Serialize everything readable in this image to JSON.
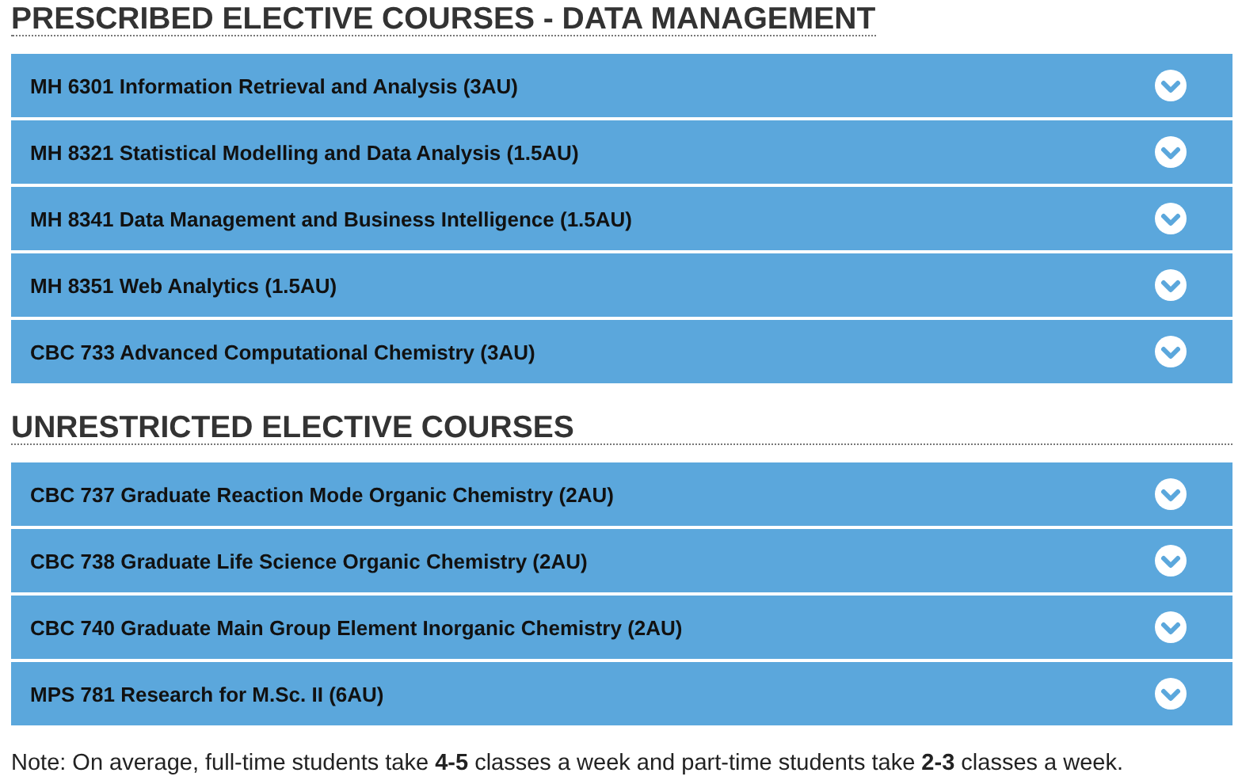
{
  "sections": [
    {
      "title": "PRESCRIBED ELECTIVE COURSES - DATA MANAGEMENT",
      "courses": [
        {
          "label": "MH 6301 Information Retrieval and Analysis (3AU)",
          "expanded": false
        },
        {
          "label": "MH 8321 Statistical Modelling and Data Analysis (1.5AU)",
          "expanded": false
        },
        {
          "label": "MH 8341 Data Management and Business Intelligence (1.5AU)",
          "expanded": false
        },
        {
          "label": "MH 8351 Web Analytics (1.5AU)",
          "expanded": false
        },
        {
          "label": "CBC 733 Advanced Computational Chemistry (3AU)",
          "expanded": false
        }
      ]
    },
    {
      "title": "UNRESTRICTED ELECTIVE COURSES",
      "courses": [
        {
          "label": "CBC 737 Graduate Reaction Mode Organic Chemistry (2AU)",
          "expanded": false
        },
        {
          "label": "CBC 738 Graduate Life Science Organic Chemistry (2AU)",
          "expanded": false
        },
        {
          "label": "CBC 740 Graduate Main Group Element Inorganic Chemistry (2AU)",
          "expanded": false
        },
        {
          "label": "MPS 781 Research for M.Sc. II (6AU)",
          "expanded": false
        }
      ]
    }
  ],
  "note": "Note: On average, full-time students take **4-5** classes a week and part-time students take **2-3** classes a week."
}
